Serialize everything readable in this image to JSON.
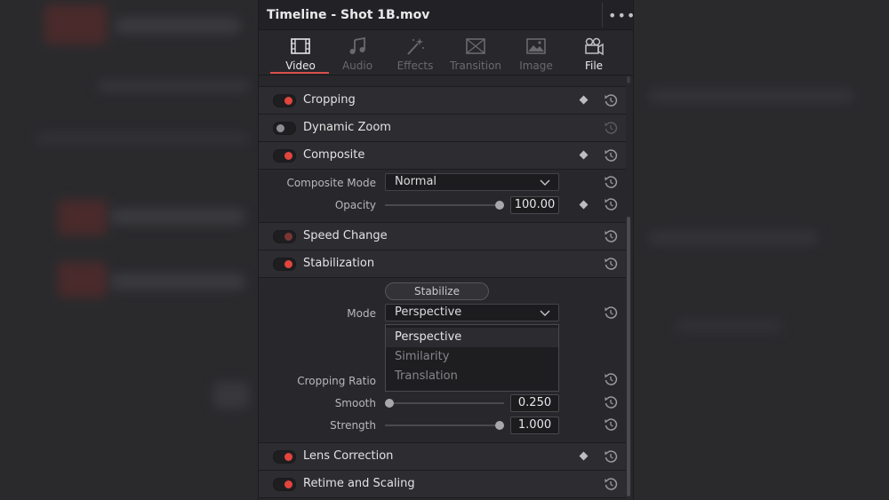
{
  "panel": {
    "title": "Timeline - Shot 1B.mov",
    "more_label": "•••"
  },
  "tabs": [
    {
      "label": "Video",
      "icon": "film-icon",
      "active": true
    },
    {
      "label": "Audio",
      "icon": "music-note-icon",
      "active": false
    },
    {
      "label": "Effects",
      "icon": "magic-wand-icon",
      "active": false
    },
    {
      "label": "Transition",
      "icon": "transition-icon",
      "active": false
    },
    {
      "label": "Image",
      "icon": "image-icon",
      "active": false
    },
    {
      "label": "File",
      "icon": "film-reel-icon",
      "active": false
    }
  ],
  "sections": {
    "cropping": {
      "label": "Cropping",
      "enabled": true
    },
    "dynamic_zoom": {
      "label": "Dynamic Zoom",
      "enabled": false
    },
    "composite": {
      "label": "Composite",
      "enabled": true,
      "mode_label": "Composite Mode",
      "mode_value": "Normal",
      "opacity_label": "Opacity",
      "opacity_value": "100.00",
      "opacity_fraction": 1.0
    },
    "speed_change": {
      "label": "Speed Change",
      "enabled": true
    },
    "stabilization": {
      "label": "Stabilization",
      "enabled": true,
      "button_label": "Stabilize",
      "mode_label": "Mode",
      "mode_value": "Perspective",
      "mode_options": [
        "Perspective",
        "Similarity",
        "Translation"
      ],
      "cropping_ratio_label": "Cropping Ratio",
      "smooth_label": "Smooth",
      "smooth_value": "0.250",
      "smooth_fraction": 0.0,
      "strength_label": "Strength",
      "strength_value": "1.000",
      "strength_fraction": 1.0
    },
    "lens_correction": {
      "label": "Lens Correction",
      "enabled": true
    },
    "retime_scaling": {
      "label": "Retime and Scaling",
      "enabled": true
    }
  },
  "colors": {
    "accent": "#d9504b",
    "toggle_on": "#e2453d"
  }
}
